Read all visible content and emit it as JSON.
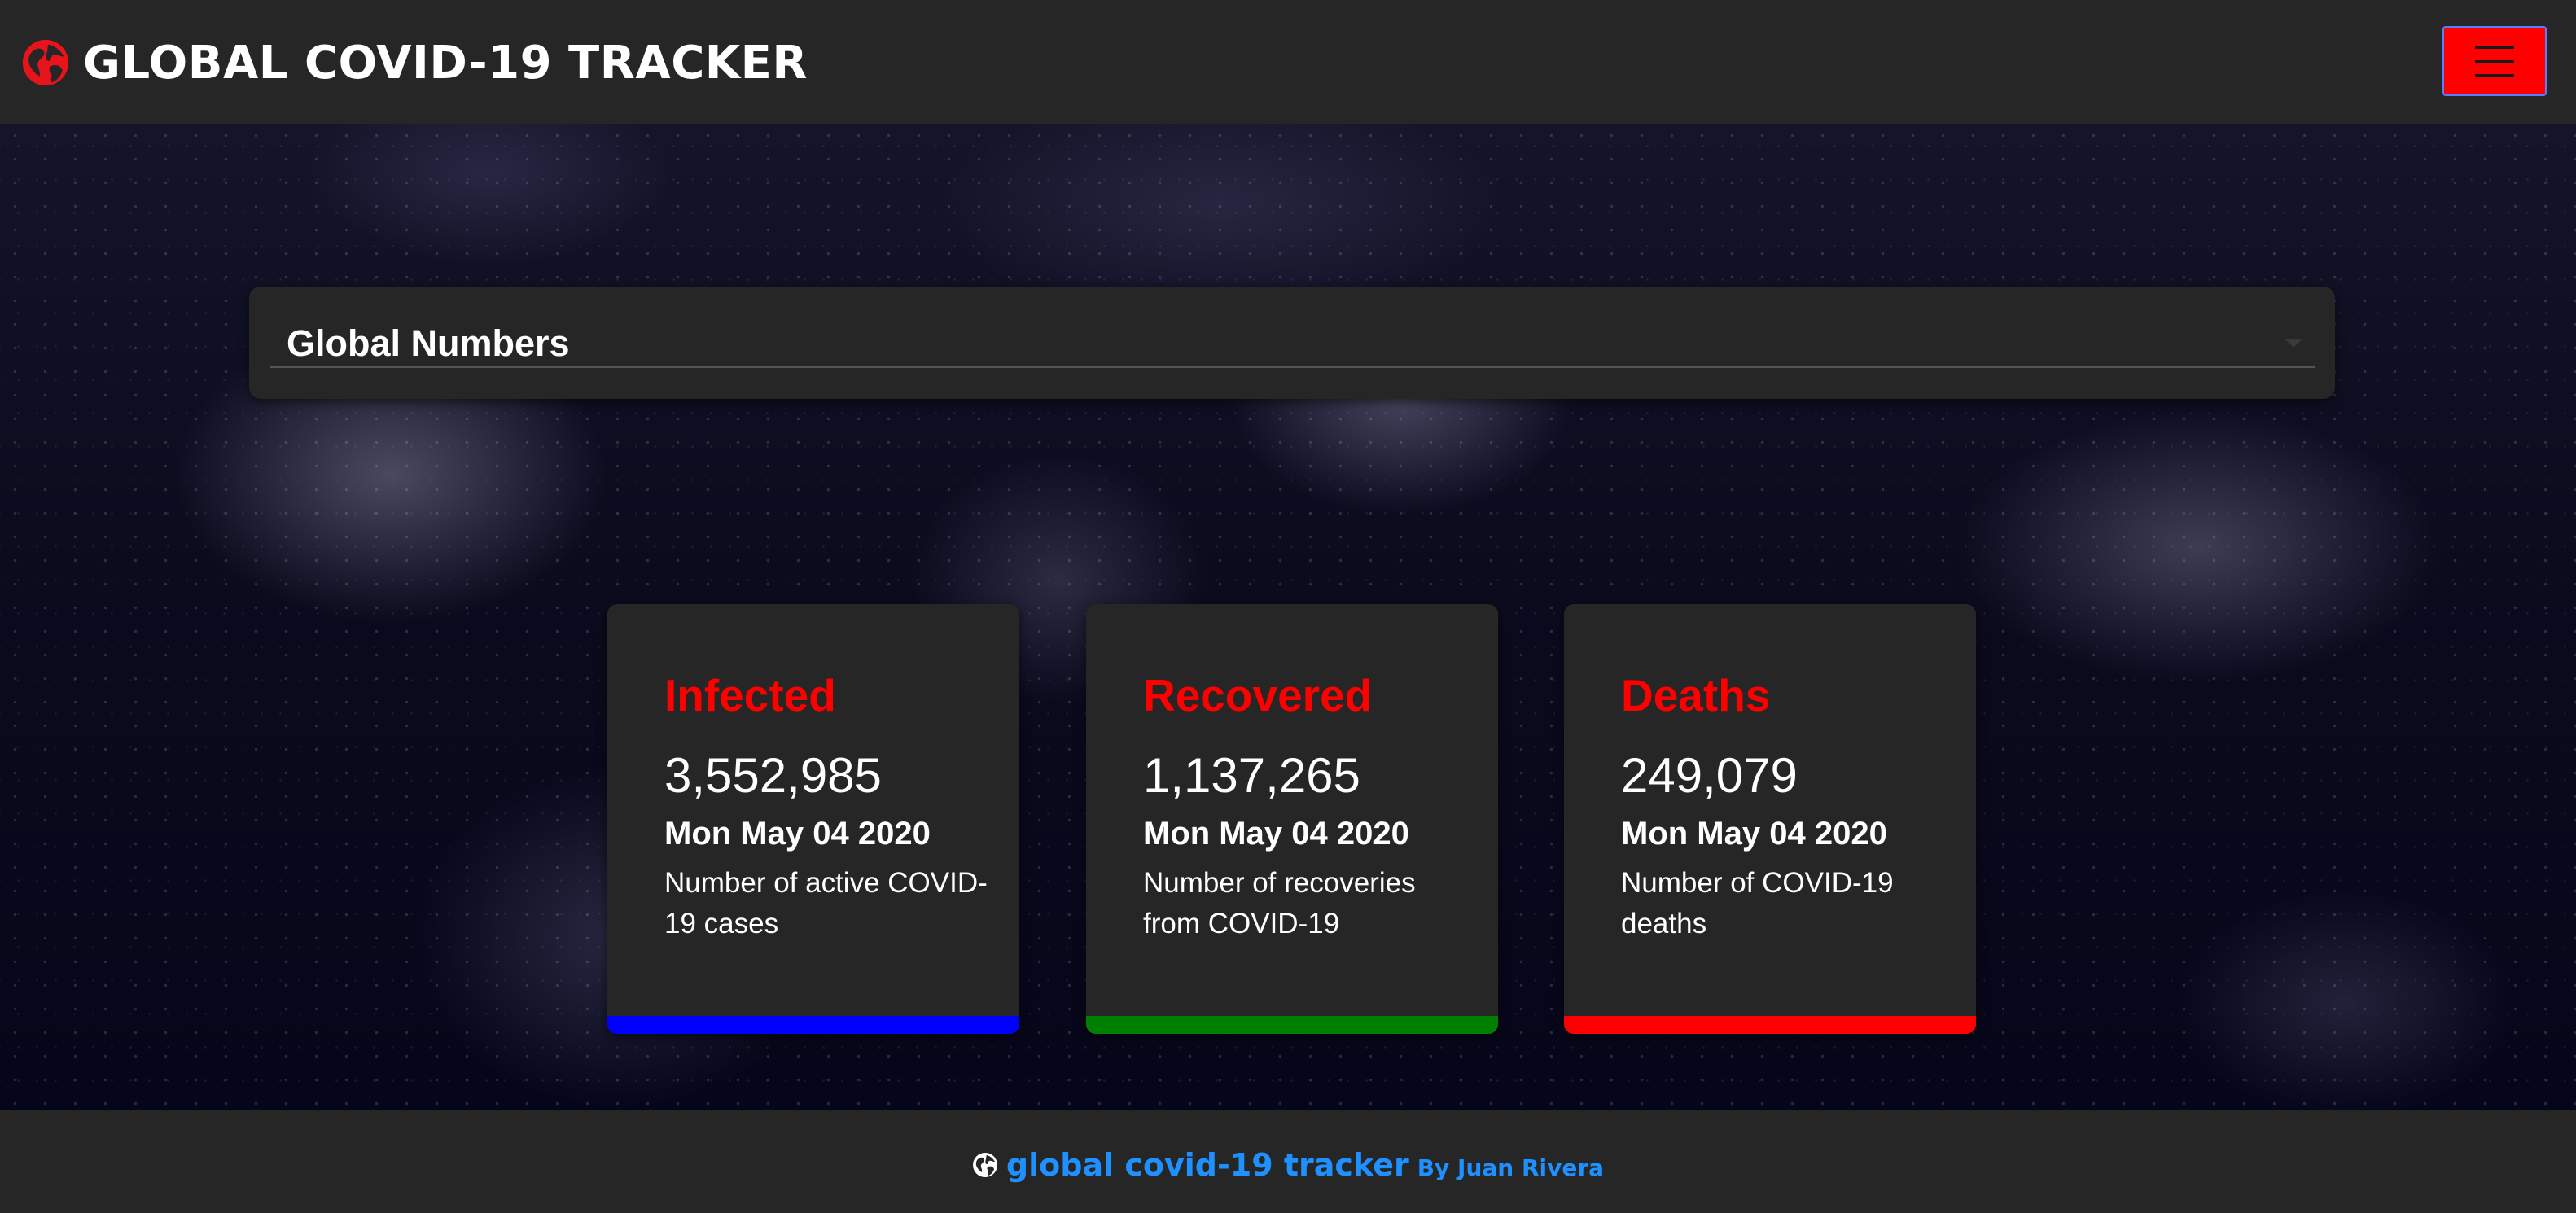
{
  "header": {
    "title": "GLOBAL COVID-19 TRACKER",
    "logo_icon": "globe-icon",
    "menu_icon": "hamburger-icon",
    "menu_color": "#ff0000"
  },
  "selector": {
    "selected": "Global Numbers"
  },
  "cards": [
    {
      "title": "Infected",
      "value": "3,552,985",
      "date": "Mon May 04 2020",
      "description": "Number of active COVID-19 cases",
      "accent": "#0000ff"
    },
    {
      "title": "Recovered",
      "value": "1,137,265",
      "date": "Mon May 04 2020",
      "description": "Number of recoveries from COVID-19",
      "accent": "#008000"
    },
    {
      "title": "Deaths",
      "value": "249,079",
      "date": "Mon May 04 2020",
      "description": "Number of COVID-19 deaths",
      "accent": "#ff0000"
    }
  ],
  "footer": {
    "icon": "globe-icon",
    "title": "global covid-19 tracker",
    "byline": "By Juan Rivera",
    "link_color": "#1e90ff"
  }
}
